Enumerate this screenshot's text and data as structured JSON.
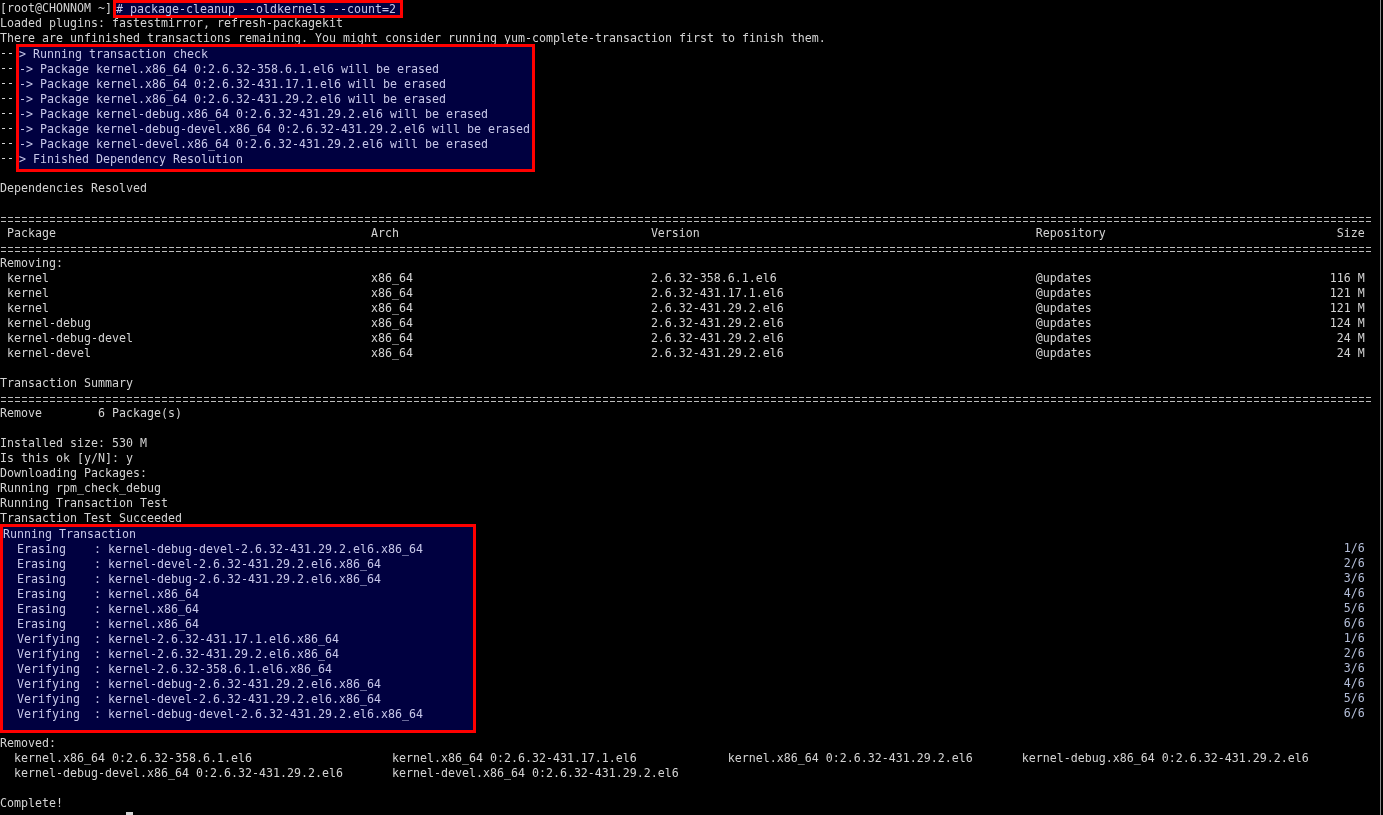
{
  "terminal": {
    "prompt": {
      "user_host": "[root@CHONNOM ~]",
      "command": "# package-cleanup --oldkernels --count=2",
      "highlighted": true
    },
    "preamble": [
      "Loaded plugins: fastestmirror, refresh-packagekit",
      "There are unfinished transactions remaining. You might consider running yum-complete-transaction first to finish them."
    ],
    "dependency_check": {
      "highlighted": true,
      "lines": [
        {
          "prefix": "--",
          "text": "> Running transaction check"
        },
        {
          "prefix": "--",
          "text": "-> Package kernel.x86_64 0:2.6.32-358.6.1.el6 will be erased"
        },
        {
          "prefix": "--",
          "text": "-> Package kernel.x86_64 0:2.6.32-431.17.1.el6 will be erased"
        },
        {
          "prefix": "--",
          "text": "-> Package kernel.x86_64 0:2.6.32-431.29.2.el6 will be erased"
        },
        {
          "prefix": "--",
          "text": "-> Package kernel-debug.x86_64 0:2.6.32-431.29.2.el6 will be erased"
        },
        {
          "prefix": "--",
          "text": "-> Package kernel-debug-devel.x86_64 0:2.6.32-431.29.2.el6 will be erased"
        },
        {
          "prefix": "--",
          "text": "-> Package kernel-devel.x86_64 0:2.6.32-431.29.2.el6 will be erased"
        },
        {
          "prefix": "--",
          "text": "> Finished Dependency Resolution"
        }
      ]
    },
    "resolved_message": "Dependencies Resolved",
    "package_table": {
      "columns": [
        "Package",
        "Arch",
        "Version",
        "Repository",
        "Size"
      ],
      "group_label": "Removing:",
      "rows": [
        {
          "package": "kernel",
          "arch": "x86_64",
          "version": "2.6.32-358.6.1.el6",
          "repository": "@updates",
          "size": "116 M"
        },
        {
          "package": "kernel",
          "arch": "x86_64",
          "version": "2.6.32-431.17.1.el6",
          "repository": "@updates",
          "size": "121 M"
        },
        {
          "package": "kernel",
          "arch": "x86_64",
          "version": "2.6.32-431.29.2.el6",
          "repository": "@updates",
          "size": "121 M"
        },
        {
          "package": "kernel-debug",
          "arch": "x86_64",
          "version": "2.6.32-431.29.2.el6",
          "repository": "@updates",
          "size": "124 M"
        },
        {
          "package": "kernel-debug-devel",
          "arch": "x86_64",
          "version": "2.6.32-431.29.2.el6",
          "repository": "@updates",
          "size": "24 M"
        },
        {
          "package": "kernel-devel",
          "arch": "x86_64",
          "version": "2.6.32-431.29.2.el6",
          "repository": "@updates",
          "size": "24 M"
        }
      ]
    },
    "summary": {
      "title": "Transaction Summary",
      "action": "Remove",
      "count": "6 Package(s)"
    },
    "log": [
      "Installed size: 530 M",
      "Is this ok [y/N]: y",
      "Downloading Packages:",
      "Running rpm_check_debug",
      "Running Transaction Test",
      "Transaction Test Succeeded"
    ],
    "transaction": {
      "title": "Running Transaction",
      "highlighted": true,
      "steps": [
        {
          "line": "Erasing    : kernel-debug-devel-2.6.32-431.29.2.el6.x86_64",
          "progress": "1/6"
        },
        {
          "line": "Erasing    : kernel-devel-2.6.32-431.29.2.el6.x86_64",
          "progress": "2/6"
        },
        {
          "line": "Erasing    : kernel-debug-2.6.32-431.29.2.el6.x86_64",
          "progress": "3/6"
        },
        {
          "line": "Erasing    : kernel.x86_64",
          "progress": "4/6"
        },
        {
          "line": "Erasing    : kernel.x86_64",
          "progress": "5/6"
        },
        {
          "line": "Erasing    : kernel.x86_64",
          "progress": "6/6"
        },
        {
          "line": "Verifying  : kernel-2.6.32-431.17.1.el6.x86_64",
          "progress": "1/6"
        },
        {
          "line": "Verifying  : kernel-2.6.32-431.29.2.el6.x86_64",
          "progress": "2/6"
        },
        {
          "line": "Verifying  : kernel-2.6.32-358.6.1.el6.x86_64",
          "progress": "3/6"
        },
        {
          "line": "Verifying  : kernel-debug-2.6.32-431.29.2.el6.x86_64",
          "progress": "4/6"
        },
        {
          "line": "Verifying  : kernel-devel-2.6.32-431.29.2.el6.x86_64",
          "progress": "5/6"
        },
        {
          "line": "Verifying  : kernel-debug-devel-2.6.32-431.29.2.el6.x86_64",
          "progress": "6/6"
        }
      ]
    },
    "removed": {
      "title": "Removed:",
      "packages": [
        "kernel.x86_64 0:2.6.32-358.6.1.el6",
        "kernel.x86_64 0:2.6.32-431.17.1.el6",
        "kernel.x86_64 0:2.6.32-431.29.2.el6",
        "kernel-debug.x86_64 0:2.6.32-431.29.2.el6",
        "kernel-debug-devel.x86_64 0:2.6.32-431.29.2.el6",
        "kernel-devel.x86_64 0:2.6.32-431.29.2.el6"
      ]
    },
    "complete_message": "Complete!"
  }
}
